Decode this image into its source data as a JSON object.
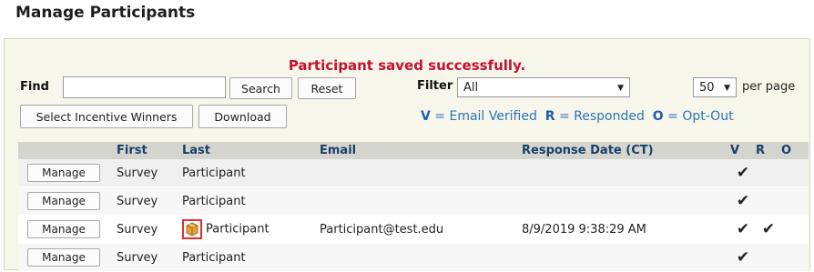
{
  "page": {
    "title": "Manage Participants"
  },
  "status": {
    "message": "Participant saved successfully."
  },
  "toolbar": {
    "find_label": "Find",
    "find_value": "",
    "search_label": "Search",
    "reset_label": "Reset",
    "filter_label": "Filter",
    "filter_value": "All",
    "page_size_value": "50",
    "per_page_label": "per page",
    "select_winners_label": "Select Incentive Winners",
    "download_label": "Download"
  },
  "legend": {
    "v_key": "V",
    "v_text": "= Email Verified",
    "r_key": "R",
    "r_text": "= Responded",
    "o_key": "O",
    "o_text": "= Opt-Out"
  },
  "table": {
    "headers": {
      "first": "First",
      "last": "Last",
      "email": "Email",
      "response_date": "Response Date (CT)",
      "v": "V",
      "r": "R",
      "o": "O"
    },
    "rows": [
      {
        "action": "Manage",
        "first": "Survey",
        "last": "Participant",
        "email": "",
        "response_date": "",
        "v": "✔",
        "r": "",
        "o": "",
        "icon": ""
      },
      {
        "action": "Manage",
        "first": "Survey",
        "last": "Participant",
        "email": "",
        "response_date": "",
        "v": "✔",
        "r": "",
        "o": "",
        "icon": ""
      },
      {
        "action": "Manage",
        "first": "Survey",
        "last": "Participant",
        "email": "Participant@test.edu",
        "response_date": "8/9/2019 9:38:29 AM",
        "v": "✔",
        "r": "✔",
        "o": "",
        "icon": "package-icon"
      },
      {
        "action": "Manage",
        "first": "Survey",
        "last": "Participant",
        "email": "",
        "response_date": "",
        "v": "✔",
        "r": "",
        "o": "",
        "icon": ""
      }
    ]
  },
  "colors": {
    "success": "#c8102e",
    "legend": "#2e74b5",
    "panel": "#f7f6ea",
    "header_row": "#d5d5cf",
    "icon_highlight": "#e03030"
  }
}
